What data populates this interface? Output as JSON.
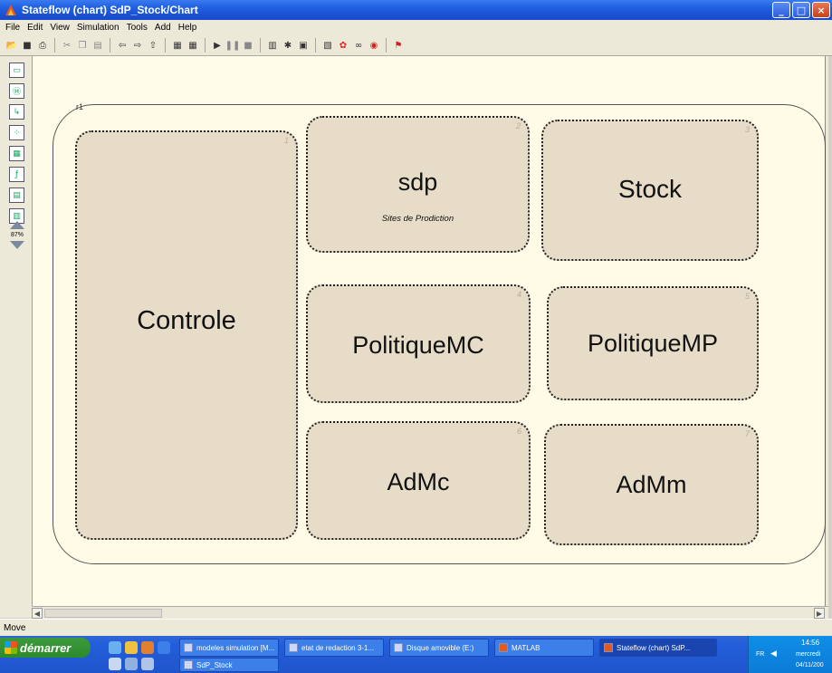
{
  "window": {
    "title": "Stateflow (chart) SdP_Stock/Chart",
    "controls": [
      "_",
      "□",
      "×"
    ]
  },
  "menu": [
    "File",
    "Edit",
    "View",
    "Simulation",
    "Tools",
    "Add",
    "Help"
  ],
  "toolbar": {
    "icons": [
      "open-icon",
      "save-icon",
      "print-icon",
      "cut-icon",
      "copy-icon",
      "paste-icon",
      "back-icon",
      "forward-icon",
      "up-icon",
      "library-icon",
      "model-icon",
      "play-icon",
      "pause-icon",
      "stop-icon",
      "build-icon",
      "debug-icon",
      "explorer-icon",
      "find-icon",
      "model-explorer-icon",
      "stateflow-icon",
      "binoculars-icon",
      "target-icon",
      "help-icon"
    ]
  },
  "palette": {
    "tools": [
      "state-tool-icon",
      "history-junction-icon",
      "default-transition-icon",
      "connective-junction-icon",
      "truth-table-icon",
      "graphical-function-icon",
      "box-tool-icon",
      "embedded-function-icon"
    ],
    "zoom": "87%"
  },
  "chart": {
    "outer_label": "r1",
    "states": [
      {
        "number": "1",
        "name": "Controle",
        "subtitle": ""
      },
      {
        "number": "2",
        "name": "sdp",
        "subtitle": "Sites de Prodiction"
      },
      {
        "number": "3",
        "name": "Stock",
        "subtitle": ""
      },
      {
        "number": "4",
        "name": "PolitiqueMC",
        "subtitle": ""
      },
      {
        "number": "5",
        "name": "PolitiqueMP",
        "subtitle": ""
      },
      {
        "number": "6",
        "name": "AdMc",
        "subtitle": ""
      },
      {
        "number": "7",
        "name": "AdMm",
        "subtitle": ""
      }
    ]
  },
  "status": {
    "text": "Move"
  },
  "taskbar": {
    "start_label": "démarrer",
    "tasks": [
      {
        "label": "modeles simulation [M...",
        "active": false
      },
      {
        "label": "etat de redaction 3-1...",
        "active": false
      },
      {
        "label": "Disque amovible (E:)",
        "active": false
      },
      {
        "label": "MATLAB",
        "active": false
      },
      {
        "label": "Stateflow (chart) SdP...",
        "active": true
      },
      {
        "label": "SdP_Stock",
        "active": false
      }
    ],
    "tray": {
      "lang": "FR",
      "time": "14:56",
      "day": "mercredi",
      "date": "04/11/200"
    }
  },
  "colors": {
    "titlebar": "#1f5fe0",
    "canvas": "#fffdea",
    "state_fill": "#e6dcc8",
    "taskbar": "#245edb",
    "start": "#2d8a2d"
  }
}
